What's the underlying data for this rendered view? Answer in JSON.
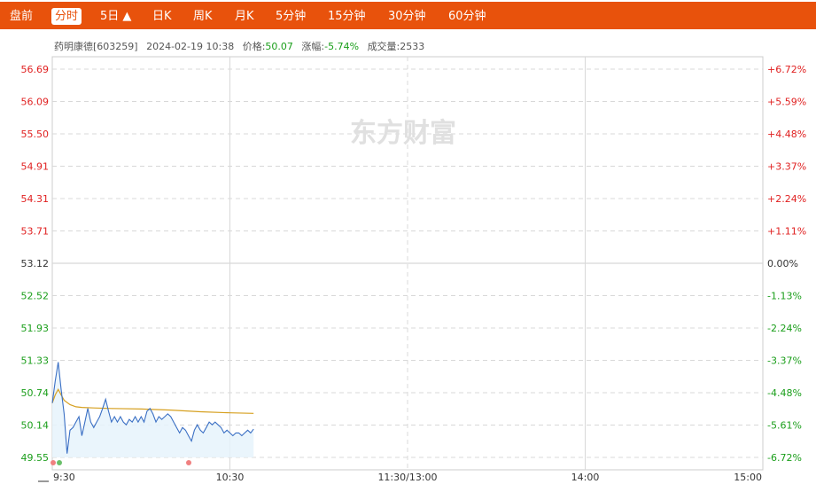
{
  "tabs": [
    {
      "label": "盘前",
      "active": false
    },
    {
      "label": "分时",
      "active": true
    },
    {
      "label": "5日 ▲",
      "active": false
    },
    {
      "label": "日K",
      "active": false
    },
    {
      "label": "周K",
      "active": false
    },
    {
      "label": "月K",
      "active": false
    },
    {
      "label": "5分钟",
      "active": false
    },
    {
      "label": "15分钟",
      "active": false
    },
    {
      "label": "30分钟",
      "active": false
    },
    {
      "label": "60分钟",
      "active": false
    }
  ],
  "info": {
    "stock": "药明康德[603259]",
    "datetime": "2024-02-19 10:38",
    "price_label": "价格:",
    "price": "50.07",
    "change_label": "涨幅:",
    "change": "-5.74%",
    "volume_label": "成交量:",
    "volume": "2533"
  },
  "watermark": "东方财富",
  "colors": {
    "accent": "#e8520c",
    "up": "#e02020",
    "down": "#1a9e1a",
    "price_line": "#3a6fc4",
    "avg_line": "#d6a020"
  },
  "chart_data": {
    "type": "line",
    "prev_close": 53.12,
    "ylim": [
      49.55,
      56.69
    ],
    "left_ticks": [
      "56.69",
      "56.09",
      "55.50",
      "54.91",
      "54.31",
      "53.71",
      "53.12",
      "52.52",
      "51.93",
      "51.33",
      "50.74",
      "50.14",
      "49.55"
    ],
    "right_ticks": [
      "+6.72%",
      "+5.59%",
      "+4.48%",
      "+3.37%",
      "+2.24%",
      "+1.11%",
      "0.00%",
      "-1.13%",
      "-2.24%",
      "-3.37%",
      "-4.48%",
      "-5.61%",
      "-6.72%"
    ],
    "x_labels": [
      "9:30",
      "10:30",
      "11:30/13:00",
      "14:00",
      "15:00"
    ],
    "total_minutes": 240,
    "series": [
      {
        "name": "price",
        "minute": [
          0,
          1,
          2,
          3,
          4,
          5,
          6,
          7,
          8,
          9,
          10,
          11,
          12,
          13,
          14,
          15,
          16,
          17,
          18,
          19,
          20,
          21,
          22,
          23,
          24,
          25,
          26,
          27,
          28,
          29,
          30,
          31,
          32,
          33,
          34,
          35,
          36,
          37,
          38,
          39,
          40,
          41,
          42,
          43,
          44,
          45,
          46,
          47,
          48,
          49,
          50,
          51,
          52,
          53,
          54,
          55,
          56,
          57,
          58,
          59,
          60,
          61,
          62,
          63,
          64,
          65,
          66,
          67,
          68
        ],
        "values": [
          50.55,
          50.95,
          51.3,
          50.8,
          50.35,
          49.62,
          50.05,
          50.1,
          50.2,
          50.3,
          49.95,
          50.2,
          50.45,
          50.2,
          50.1,
          50.2,
          50.3,
          50.45,
          50.62,
          50.4,
          50.2,
          50.3,
          50.2,
          50.3,
          50.2,
          50.15,
          50.25,
          50.2,
          50.3,
          50.2,
          50.3,
          50.2,
          50.4,
          50.45,
          50.35,
          50.2,
          50.3,
          50.25,
          50.3,
          50.35,
          50.3,
          50.2,
          50.1,
          50.0,
          50.1,
          50.05,
          49.95,
          49.85,
          50.05,
          50.15,
          50.05,
          50.0,
          50.1,
          50.2,
          50.15,
          50.2,
          50.15,
          50.1,
          50.0,
          50.05,
          50.0,
          49.95,
          50.0,
          50.0,
          49.95,
          50.0,
          50.05,
          50.0,
          50.07
        ]
      },
      {
        "name": "avg",
        "minute": [
          0,
          1,
          2,
          3,
          4,
          6,
          8,
          10,
          14,
          20,
          30,
          40,
          50,
          60,
          68
        ],
        "values": [
          50.55,
          50.7,
          50.8,
          50.7,
          50.6,
          50.52,
          50.48,
          50.47,
          50.46,
          50.45,
          50.44,
          50.42,
          50.39,
          50.37,
          50.36
        ]
      }
    ],
    "grid": true
  }
}
